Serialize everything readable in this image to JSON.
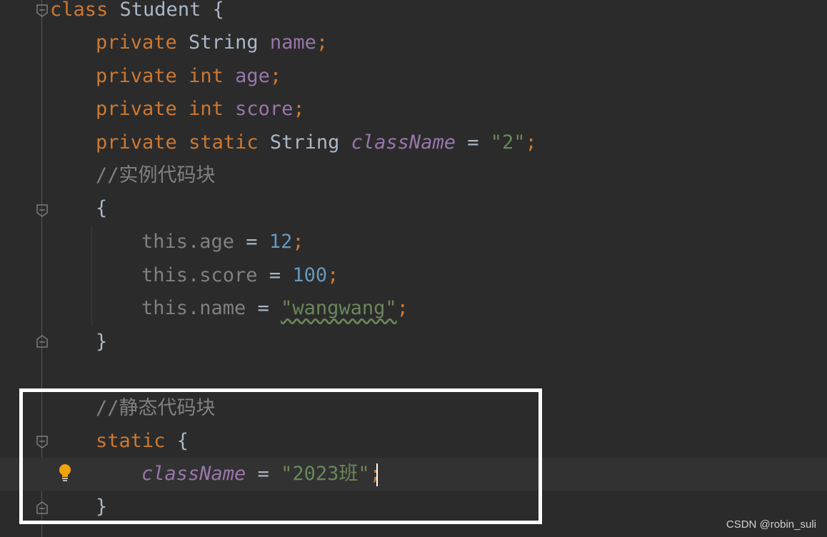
{
  "editor": {
    "lines": {
      "l1": {
        "t1": "class",
        "t2": " Student {"
      },
      "l2": {
        "t1": "private",
        "t2": " String ",
        "t3": "name",
        "t4": ";"
      },
      "l3": {
        "t1": "private",
        "t2": " ",
        "t3": "int",
        "t4": " ",
        "t5": "age",
        "t6": ";"
      },
      "l4": {
        "t1": "private",
        "t2": " ",
        "t3": "int",
        "t4": " ",
        "t5": "score",
        "t6": ";"
      },
      "l5": {
        "t1": "private",
        "t2": " ",
        "t3": "static",
        "t4": " String ",
        "t5": "className",
        "t6": " = ",
        "t7": "\"2\"",
        "t8": ";"
      },
      "l6": {
        "t1": "//实例代码块"
      },
      "l7": {
        "t1": "{"
      },
      "l8": {
        "t1": "this.age",
        "t2": " = ",
        "t3": "12",
        "t4": ";"
      },
      "l9": {
        "t1": "this.score",
        "t2": " = ",
        "t3": "100",
        "t4": ";"
      },
      "l10": {
        "t1": "this.name",
        "t2": " = ",
        "t3": "\"wangwang\"",
        "t4": ";"
      },
      "l11": {
        "t1": "}"
      },
      "l12": {
        "t1": "//静态代码块"
      },
      "l13": {
        "t1": "static",
        "t2": " {"
      },
      "l14": {
        "t1": "className",
        "t2": " = ",
        "t3": "\"2023班\"",
        "t4": ";"
      },
      "l15": {
        "t1": "}"
      }
    }
  },
  "colors": {
    "background": "#2b2b2b",
    "keyword": "#cc7832",
    "field": "#9876aa",
    "string": "#6a8759",
    "number": "#6897bb",
    "comment": "#808080",
    "highlight_border": "#ffffff"
  },
  "icons": {
    "fold": "fold-marker-icon",
    "bulb": "lightbulb-icon"
  },
  "watermark": "CSDN @robin_suli"
}
